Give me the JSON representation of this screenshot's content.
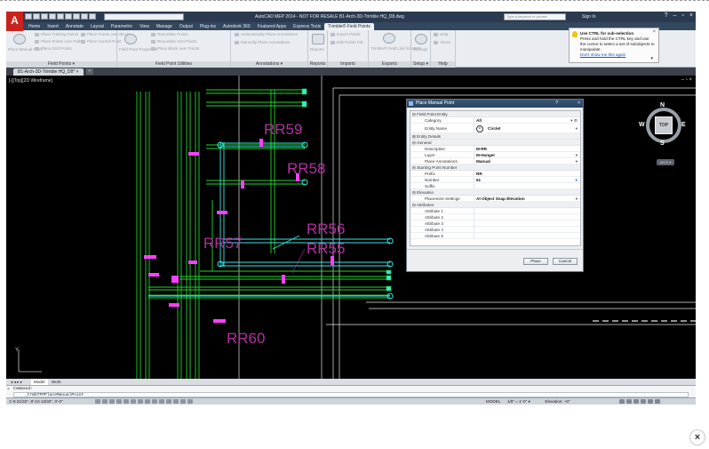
{
  "window": {
    "title": "AutoCAD MEP 2014 - NOT FOR RESALE   B1-Arch-3D-Trimble HQ_D8.dwg",
    "search_placeholder": "Type a keyword or phrase",
    "signin": "Sign In",
    "logo": "A"
  },
  "tabs": [
    "Home",
    "Insert",
    "Annotate",
    "Layout",
    "Parametric",
    "View",
    "Manage",
    "Output",
    "Plug-ins",
    "Autodesk 360",
    "Featured Apps",
    "Express Tools",
    "Trimble® Field Points"
  ],
  "ribbon": {
    "panels": [
      {
        "title": "Field Points ▾",
        "tools": [
          "Place Manual Point",
          "Place Training Points",
          "Place Points over Path",
          "Place Grid Points",
          "Place Points over Blocks",
          "Place Control Point"
        ]
      },
      {
        "title": "Field Point Utilities",
        "tools": [
          "Field Point Properties",
          "Renumber Points",
          "Renumber Grid Points",
          "Place Block over Points"
        ]
      },
      {
        "title": "Annotations ▾",
        "tools": [
          "Automatically Place Annotations",
          "Manually Place Annotations"
        ]
      },
      {
        "title": "Reports",
        "tools": [
          "Reports"
        ]
      },
      {
        "title": "Imports",
        "tools": [
          "Import Points",
          "Edit Points File"
        ]
      },
      {
        "title": "Exports",
        "tools": [
          "Trimble® Field Link for MEP"
        ]
      },
      {
        "title": "Setup ▾",
        "tools": [
          "Settings"
        ]
      },
      {
        "title": "Help",
        "tools": [
          "Help",
          "About"
        ]
      }
    ]
  },
  "tooltip": {
    "heading": "Use CTRL for sub-selection",
    "body": "Press and hold the CTRL key and use the cursor to select a set of subobjects to manipulate.",
    "link": "Don't show me this again"
  },
  "file_tab": "B1-Arch-3D-Trimble HQ_D8*",
  "viewport_label": "[-][Top][2D Wireframe]",
  "viewport_controls": "– ▫ ×",
  "viewcube": {
    "top": "TOP",
    "n": "N",
    "s": "S",
    "e": "E",
    "w": "W",
    "wcs": "WCS ▾"
  },
  "drawing_labels": [
    "RR59",
    "RR58",
    "RR57",
    "RR56",
    "RR55",
    "RR60"
  ],
  "colors": {
    "pipe": "#21d62b",
    "pipe_light": "#8bf08f",
    "hanger": "#ff3fff",
    "label": "#b0309f",
    "cyan": "#36e6e6",
    "wall": "#e6e6e6"
  },
  "dialog": {
    "title": "Place Manual Point",
    "q": "?",
    "close": "×",
    "groups": {
      "entity": "Field Point Entity",
      "details": "Entity Details",
      "general": "General",
      "starting": "Starting Point Number",
      "elevation": "Elevation",
      "attributes": "Attributes"
    },
    "rows": {
      "category": {
        "k": "Category",
        "v": "All"
      },
      "entity_name": {
        "k": "Entity Name",
        "v": "Circlet"
      },
      "description": {
        "k": "Description",
        "v": "M-RR"
      },
      "layer": {
        "k": "Layer",
        "v": "M-Hanger"
      },
      "place_annotations": {
        "k": "Place Annotations",
        "v": "Manual"
      },
      "prefix": {
        "k": "Prefix",
        "v": "RR"
      },
      "number": {
        "k": "Number",
        "v": "61"
      },
      "suffix": {
        "k": "Suffix",
        "v": ""
      },
      "placement": {
        "k": "Placement Settings",
        "v": "At Object Snap Elevation"
      },
      "attr1": {
        "k": "Attribute 1",
        "v": ""
      },
      "attr2": {
        "k": "Attribute 2",
        "v": ""
      },
      "attr3": {
        "k": "Attribute 3",
        "v": ""
      },
      "attr4": {
        "k": "Attribute 4",
        "v": ""
      },
      "attr5": {
        "k": "Attribute 5",
        "v": ""
      }
    },
    "place_btn": "Place",
    "cancel_btn": "Cancel"
  },
  "layout_tabs": [
    "Model",
    "Work"
  ],
  "command": {
    "label": "Command:",
    "input": "_trmbTFPPlaceManualPoint"
  },
  "status": {
    "coords": "1'-8 21/32\", 8'-10 13/32\", 0'-0\"",
    "model": "MODEL",
    "scale": "1/8\" = 1'-0\" ▾",
    "elevation": "Elevation: +0\""
  },
  "close_overlay": "×"
}
